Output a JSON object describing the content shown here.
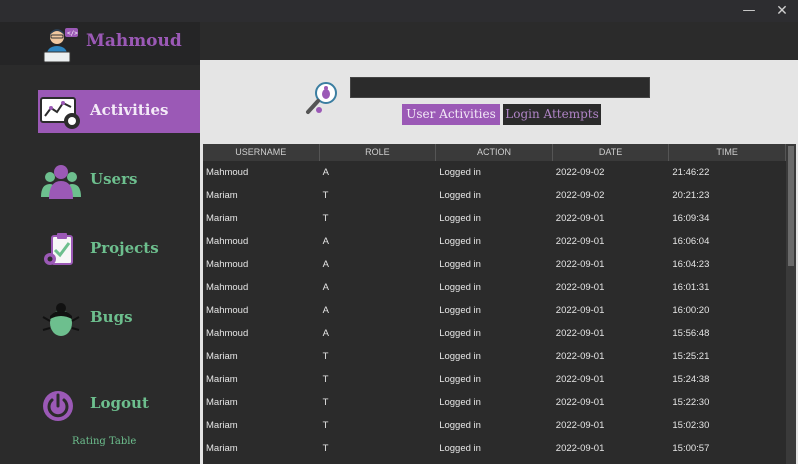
{
  "window": {
    "minimize_label": "—",
    "close_label": "✕"
  },
  "sidebar": {
    "user_name": "Mahmoud",
    "items": [
      {
        "label": "Activities",
        "icon": "activities-icon",
        "active": true
      },
      {
        "label": "Users",
        "icon": "users-icon",
        "active": false
      },
      {
        "label": "Projects",
        "icon": "projects-icon",
        "active": false
      },
      {
        "label": "Bugs",
        "icon": "bug-icon",
        "active": false
      },
      {
        "label": "Logout",
        "icon": "power-icon",
        "active": false
      }
    ],
    "rating_link": "Rating Table"
  },
  "main": {
    "search": {
      "value": "",
      "placeholder": ""
    },
    "tabs": [
      {
        "label": "User Activities",
        "active": true
      },
      {
        "label": "Login Attempts",
        "active": false
      }
    ],
    "table": {
      "columns": [
        "USERNAME",
        "ROLE",
        "ACTION",
        "DATE",
        "TIME"
      ],
      "rows": [
        [
          "Mahmoud",
          "A",
          "Logged in",
          "2022-09-02",
          "21:46:22"
        ],
        [
          "Mariam",
          "T",
          "Logged in",
          "2022-09-02",
          "20:21:23"
        ],
        [
          "Mariam",
          "T",
          "Logged in",
          "2022-09-01",
          "16:09:34"
        ],
        [
          "Mahmoud",
          "A",
          "Logged in",
          "2022-09-01",
          "16:06:04"
        ],
        [
          "Mahmoud",
          "A",
          "Logged in",
          "2022-09-01",
          "16:04:23"
        ],
        [
          "Mahmoud",
          "A",
          "Logged in",
          "2022-09-01",
          "16:01:31"
        ],
        [
          "Mahmoud",
          "A",
          "Logged in",
          "2022-09-01",
          "16:00:20"
        ],
        [
          "Mahmoud",
          "A",
          "Logged in",
          "2022-09-01",
          "15:56:48"
        ],
        [
          "Mariam",
          "T",
          "Logged in",
          "2022-09-01",
          "15:25:21"
        ],
        [
          "Mariam",
          "T",
          "Logged in",
          "2022-09-01",
          "15:24:38"
        ],
        [
          "Mariam",
          "T",
          "Logged in",
          "2022-09-01",
          "15:22:30"
        ],
        [
          "Mariam",
          "T",
          "Logged in",
          "2022-09-01",
          "15:02:30"
        ],
        [
          "Mariam",
          "T",
          "Logged in",
          "2022-09-01",
          "15:00:57"
        ]
      ]
    }
  },
  "colors": {
    "accent": "#9b59b6",
    "nav_text": "#6dbf8e",
    "sidebar_bg": "#2b2b2b",
    "main_bg": "#e5e5e5"
  }
}
